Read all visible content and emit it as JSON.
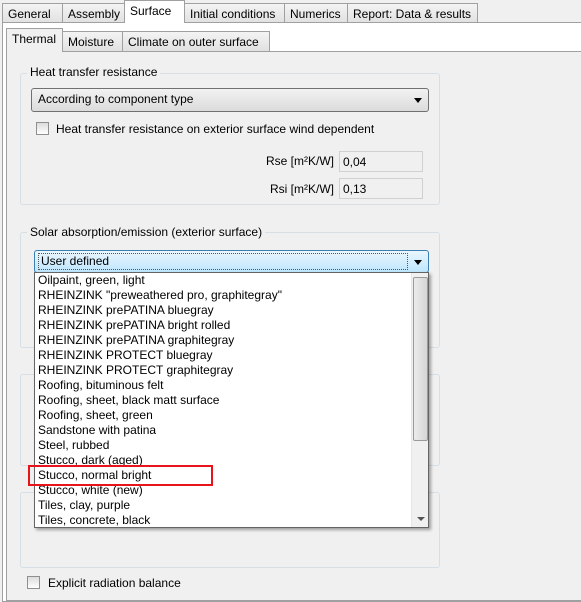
{
  "main_tabs": [
    "General",
    "Assembly",
    "Surface",
    "Initial conditions",
    "Numerics",
    "Report: Data & results"
  ],
  "active_main_tab": "Surface",
  "sub_tabs": [
    "Thermal",
    "Moisture",
    "Climate on outer surface"
  ],
  "active_sub_tab": "Thermal",
  "heat_transfer": {
    "title": "Heat transfer resistance",
    "mode": "According to component type",
    "wind_checkbox_label": "Heat transfer resistance on exterior surface wind dependent",
    "wind_checked": false,
    "rse_label": "Rse  [m²K/W]",
    "rse_value": "0,04",
    "rsi_label": "Rsi  [m²K/W]",
    "rsi_value": "0,13"
  },
  "solar": {
    "title": "Solar absorption/emission (exterior surface)",
    "selected": "User defined",
    "options": [
      "Oilpaint, green, light",
      "RHEINZINK \"preweathered pro, graphitegray\"",
      "RHEINZINK prePATINA bluegray",
      "RHEINZINK prePATINA bright rolled",
      "RHEINZINK prePATINA graphitegray",
      "RHEINZINK PROTECT bluegray",
      "RHEINZINK PROTECT graphitegray",
      "Roofing, bituminous felt",
      "Roofing, sheet, black matt surface",
      "Roofing, sheet, green",
      "Sandstone with patina",
      "Steel, rubbed",
      "Stucco, dark (aged)",
      "Stucco, normal bright",
      "Stucco, white (new)",
      "Tiles, clay, purple",
      "Tiles, concrete, black"
    ],
    "highlighted_option": "Stucco, normal bright",
    "highlight_color": "#e8141b"
  },
  "explicit_radiation": {
    "label": "Explicit radiation balance",
    "checked": false
  }
}
